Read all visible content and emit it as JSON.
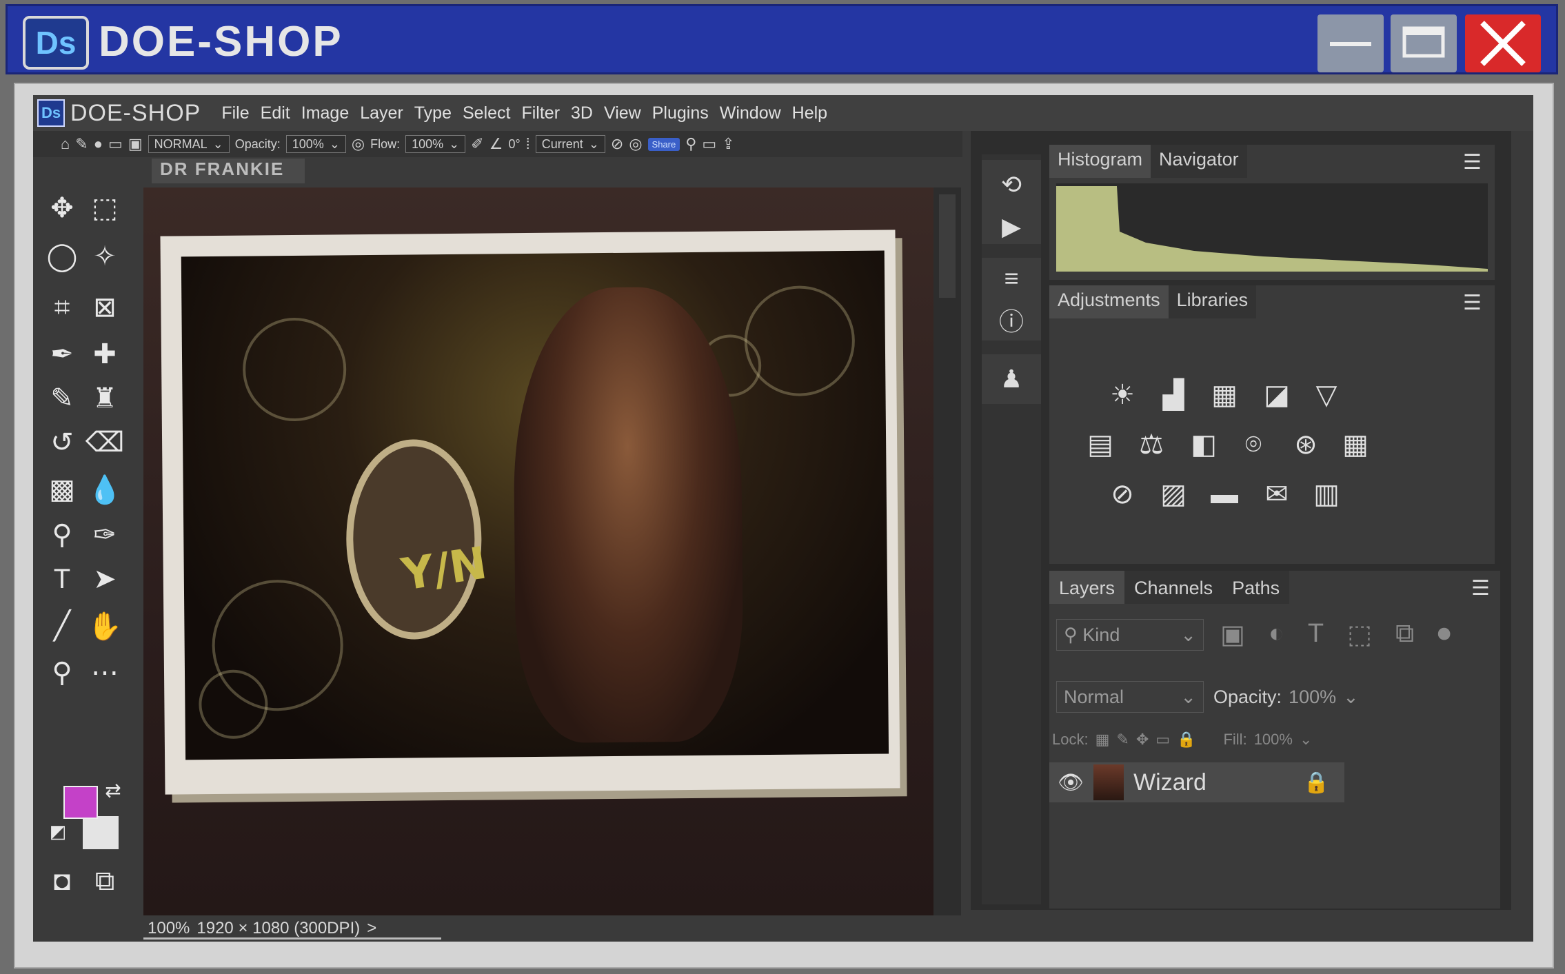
{
  "window": {
    "logo": "Ds",
    "title": "DOE-SHOP",
    "minimize_icon": "minimize-icon",
    "maximize_icon": "maximize-icon",
    "close_icon": "close-icon"
  },
  "app": {
    "logo": "Ds",
    "name": "DOE-SHOP",
    "menus": [
      "File",
      "Edit",
      "Image",
      "Layer",
      "Type",
      "Select",
      "Filter",
      "3D",
      "View",
      "Plugins",
      "Window",
      "Help"
    ]
  },
  "options_bar": {
    "mode": "NORMAL",
    "opacity_label": "Opacity:",
    "opacity_value": "100%",
    "flow_label": "Flow:",
    "flow_value": "100%",
    "angle_value": "0°",
    "sample": "Current",
    "share": "Share"
  },
  "document": {
    "tab_title": "DR FRANKIE",
    "art_text": "Y/N"
  },
  "status": {
    "zoom": "100%",
    "dimensions": "1920 × 1080 (300DPI)",
    "arrow": ">"
  },
  "colors": {
    "foreground": "#c441c8",
    "background": "#e4e4e4",
    "title_bar": "#2436a3",
    "histogram": "#b8be82"
  },
  "panels": {
    "histogram": {
      "tabs": [
        "Histogram",
        "Navigator"
      ]
    },
    "adjustments": {
      "tabs": [
        "Adjustments",
        "Libraries"
      ]
    },
    "layers": {
      "tabs": [
        "Layers",
        "Channels",
        "Paths"
      ],
      "filter_placeholder": "Kind",
      "blend_mode": "Normal",
      "opacity_label": "Opacity:",
      "opacity_value": "100%",
      "lock_label": "Lock:",
      "fill_label": "Fill:",
      "fill_value": "100%",
      "layer_name": "Wizard"
    }
  }
}
